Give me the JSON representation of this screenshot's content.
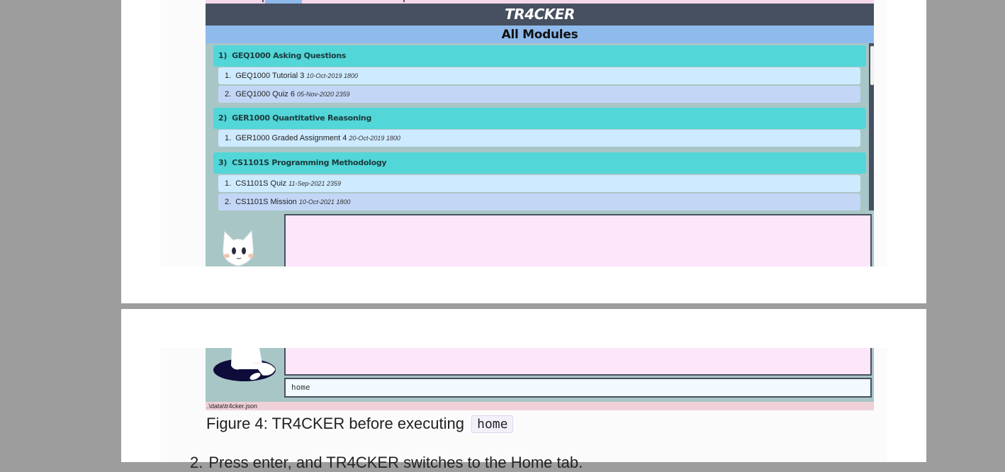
{
  "app": {
    "title": "TR4CKER",
    "view_title": "All Modules",
    "storage_path": ".\\data\\tr4cker.json",
    "command_input": "home"
  },
  "modules": [
    {
      "index": "1)",
      "name": "GEQ1000 Asking Questions",
      "tasks": [
        {
          "index": "1.",
          "name": "GEQ1000 Tutorial 3",
          "deadline": "10-Oct-2019 1800"
        },
        {
          "index": "2.",
          "name": "GEQ1000 Quiz 6",
          "deadline": "05-Nov-2020 2359"
        }
      ]
    },
    {
      "index": "2)",
      "name": "GER1000 Quantitative Reasoning",
      "tasks": [
        {
          "index": "1.",
          "name": "GER1000 Graded Assignment 4",
          "deadline": "20-Oct-2019 1800"
        }
      ]
    },
    {
      "index": "3)",
      "name": "CS1101S Programming Methodology",
      "tasks": [
        {
          "index": "1.",
          "name": "CS1101S Quiz",
          "deadline": "11-Sep-2021 2359"
        },
        {
          "index": "2.",
          "name": "CS1101S Mission",
          "deadline": "10-Oct-2021 1800"
        }
      ]
    }
  ],
  "document": {
    "caption_text": "Figure 4: TR4CKER before executing",
    "caption_code": "home",
    "next_step_number": "2.",
    "next_step_text": "Press enter, and TR4CKER switches to the Home tab."
  },
  "colors": {
    "title_bar": "#475060",
    "view_header": "#8fbbec",
    "module_header": "#52d6d8",
    "task_light": "#ceeaff",
    "task_dark": "#c3d6f6",
    "result_box": "#fde6f9",
    "status_bar": "#f0d0d8",
    "viewer_background": "#9d9d9d"
  }
}
